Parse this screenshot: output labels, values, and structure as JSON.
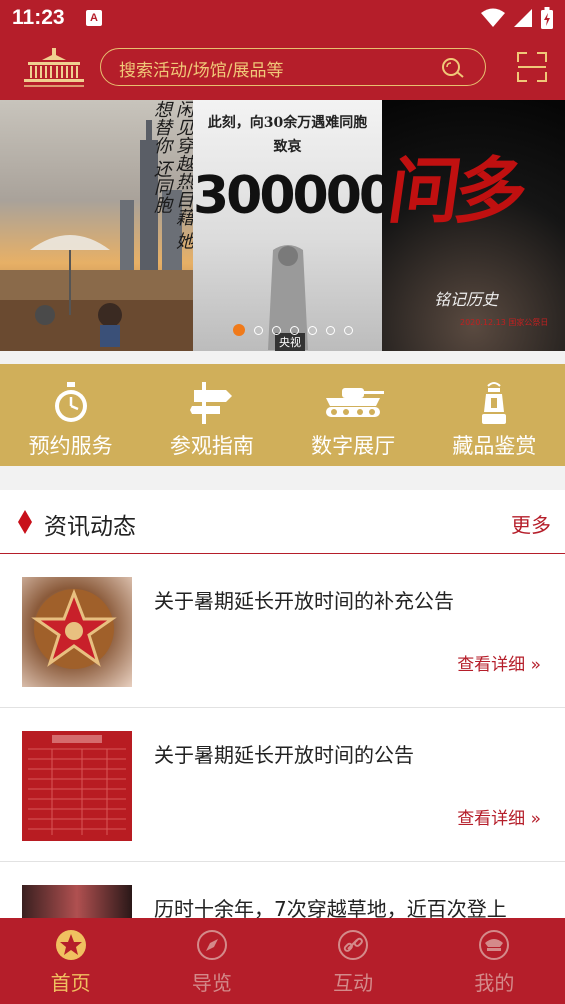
{
  "status_bar": {
    "time": "11:23",
    "notification_badge": "A"
  },
  "header": {
    "search_placeholder": "搜索活动/场馆/展品等"
  },
  "banner": {
    "panel1_text": "闲见穿越热目藉 她想替你 还同胞",
    "panel2_title": "此刻，向30余万遇难同胞",
    "panel2_sub": "致哀",
    "panel2_number": "300000",
    "panel2_source": "央视",
    "panel3_title": "问多",
    "panel3_sub": "铭记历史",
    "panel3_small": "2020.12.13 国家公祭日",
    "active_dot": 0
  },
  "quick_links": [
    {
      "label": "预约服务",
      "icon": "stopwatch-icon"
    },
    {
      "label": "参观指南",
      "icon": "signpost-icon"
    },
    {
      "label": "数字展厅",
      "icon": "tank-icon"
    },
    {
      "label": "藏品鉴赏",
      "icon": "lantern-icon"
    }
  ],
  "news": {
    "title": "资讯动态",
    "more": "更多",
    "detail_label": "查看详细 »",
    "items": [
      {
        "title": "关于暑期延长开放时间的补充公告"
      },
      {
        "title": "关于暑期延长开放时间的公告"
      },
      {
        "title": "历时十余年，7次穿越草地，近百次登上"
      }
    ]
  },
  "tabs": [
    {
      "label": "首页",
      "icon": "star-badge-icon",
      "active": true
    },
    {
      "label": "导览",
      "icon": "compass-icon",
      "active": false
    },
    {
      "label": "互动",
      "icon": "link-icon",
      "active": false
    },
    {
      "label": "我的",
      "icon": "cap-icon",
      "active": false
    }
  ],
  "colors": {
    "primary": "#b51e2a",
    "gold": "#d0af5a",
    "accent": "#f0c060"
  }
}
